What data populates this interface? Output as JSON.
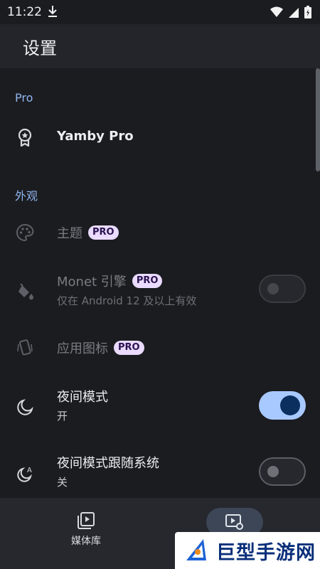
{
  "status": {
    "time": "11:22"
  },
  "appbar": {
    "title": "设置"
  },
  "sections": {
    "pro": {
      "header": "Pro",
      "item_title": "Yamby Pro"
    },
    "appearance": {
      "header": "外观",
      "theme": {
        "title": "主题",
        "badge": "PRO"
      },
      "monet": {
        "title": "Monet 引擎",
        "badge": "PRO",
        "subtitle": "仅在 Android 12 及以上有效",
        "enabled": false
      },
      "app_icon": {
        "title": "应用图标",
        "badge": "PRO"
      },
      "night_mode": {
        "title": "夜间模式",
        "subtitle": "开",
        "enabled": true
      },
      "night_follow_system": {
        "title": "夜间模式跟随系统",
        "subtitle": "关",
        "enabled": false
      }
    }
  },
  "bottom_nav": {
    "items": [
      {
        "label": "媒体库",
        "icon": "media-library-icon"
      },
      {
        "label": "",
        "icon": "settings-play-icon",
        "selected": true
      }
    ]
  },
  "watermark": {
    "text": "巨型手游网"
  },
  "colors": {
    "accent": "#8fb6ef",
    "toggle_on": "#a8c9ff",
    "badge_bg": "#eadbff"
  }
}
